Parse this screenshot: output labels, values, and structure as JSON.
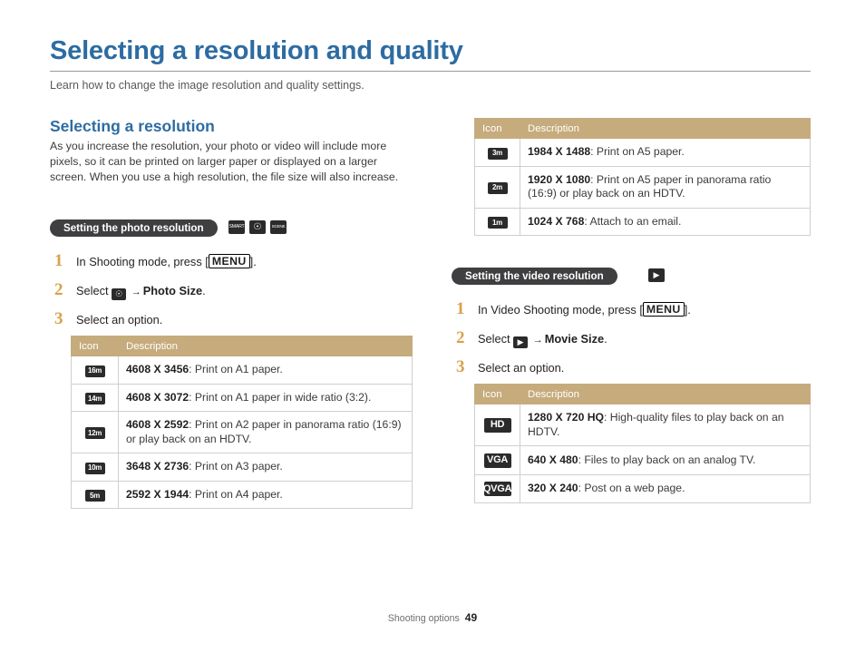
{
  "page": {
    "title": "Selecting a resolution and quality",
    "subtitle": "Learn how to change the image resolution and quality settings.",
    "footer_label": "Shooting options",
    "footer_page": "49",
    "accent_color": "#2d6ca2",
    "table_header_color": "#c6ab7d",
    "step_number_color": "#d8a24a"
  },
  "left": {
    "section_heading": "Selecting a resolution",
    "section_body": "As you increase the resolution, your photo or video will include more pixels, so it can be printed on larger paper or displayed on a larger screen. When you use a high resolution, the file size will also increase.",
    "pill": "Setting the photo resolution",
    "mode_icons": [
      "smart-auto-icon",
      "camera-icon",
      "scene-icon"
    ],
    "steps": [
      {
        "num": "1",
        "text_before": "In Shooting mode, press [",
        "key": "MENU",
        "text_after": "]."
      },
      {
        "num": "2",
        "text_before": "Select",
        "icon": "camera-icon",
        "arrow": "→",
        "bold": "Photo Size",
        "text_after": "."
      },
      {
        "num": "3",
        "text_before": "Select an option."
      }
    ],
    "table": {
      "headers": [
        "Icon",
        "Description"
      ],
      "rows": [
        {
          "icon": "16m",
          "icon_size": "small",
          "value": "4608 X 3456",
          "desc": ": Print on A1 paper."
        },
        {
          "icon": "14m",
          "icon_size": "small",
          "value": "4608 X 3072",
          "desc": ": Print on A1 paper in wide ratio (3:2)."
        },
        {
          "icon": "12m",
          "icon_size": "small",
          "value": "4608 X 2592",
          "desc": ": Print on A2 paper in panorama ratio (16:9) or play back on an HDTV."
        },
        {
          "icon": "10m",
          "icon_size": "small",
          "value": "3648 X 2736",
          "desc": ": Print on A3 paper."
        },
        {
          "icon": "5m",
          "icon_size": "small",
          "value": "2592 X 1944",
          "desc": ": Print on A4 paper."
        }
      ]
    }
  },
  "right_top": {
    "table": {
      "headers": [
        "Icon",
        "Description"
      ],
      "rows": [
        {
          "icon": "3m",
          "icon_size": "small",
          "value": "1984 X 1488",
          "desc": ": Print on A5 paper."
        },
        {
          "icon": "2m",
          "icon_size": "small",
          "value": "1920 X 1080",
          "desc": ": Print on A5 paper in panorama ratio (16:9) or play back on an HDTV."
        },
        {
          "icon": "1m",
          "icon_size": "small",
          "value": "1024 X 768",
          "desc": ": Attach to an email."
        }
      ]
    }
  },
  "right": {
    "pill": "Setting the video resolution",
    "mode_icons": [
      "movie-icon"
    ],
    "steps": [
      {
        "num": "1",
        "text_before": "In Video Shooting mode, press [",
        "key": "MENU",
        "text_after": "]."
      },
      {
        "num": "2",
        "text_before": "Select",
        "icon": "movie-icon",
        "arrow": "→",
        "bold": "Movie Size",
        "text_after": "."
      },
      {
        "num": "3",
        "text_before": "Select an option."
      }
    ],
    "table": {
      "headers": [
        "Icon",
        "Description"
      ],
      "rows": [
        {
          "icon": "HD",
          "icon_size": "big",
          "value": "1280 X 720 HQ",
          "desc": ": High-quality files to play back on an HDTV."
        },
        {
          "icon": "VGA",
          "icon_size": "big",
          "value": "640 X 480",
          "desc": ": Files to play back on an analog TV."
        },
        {
          "icon": "QVGA",
          "icon_size": "big",
          "value": "320 X 240",
          "desc": ": Post on a web page."
        }
      ]
    }
  }
}
